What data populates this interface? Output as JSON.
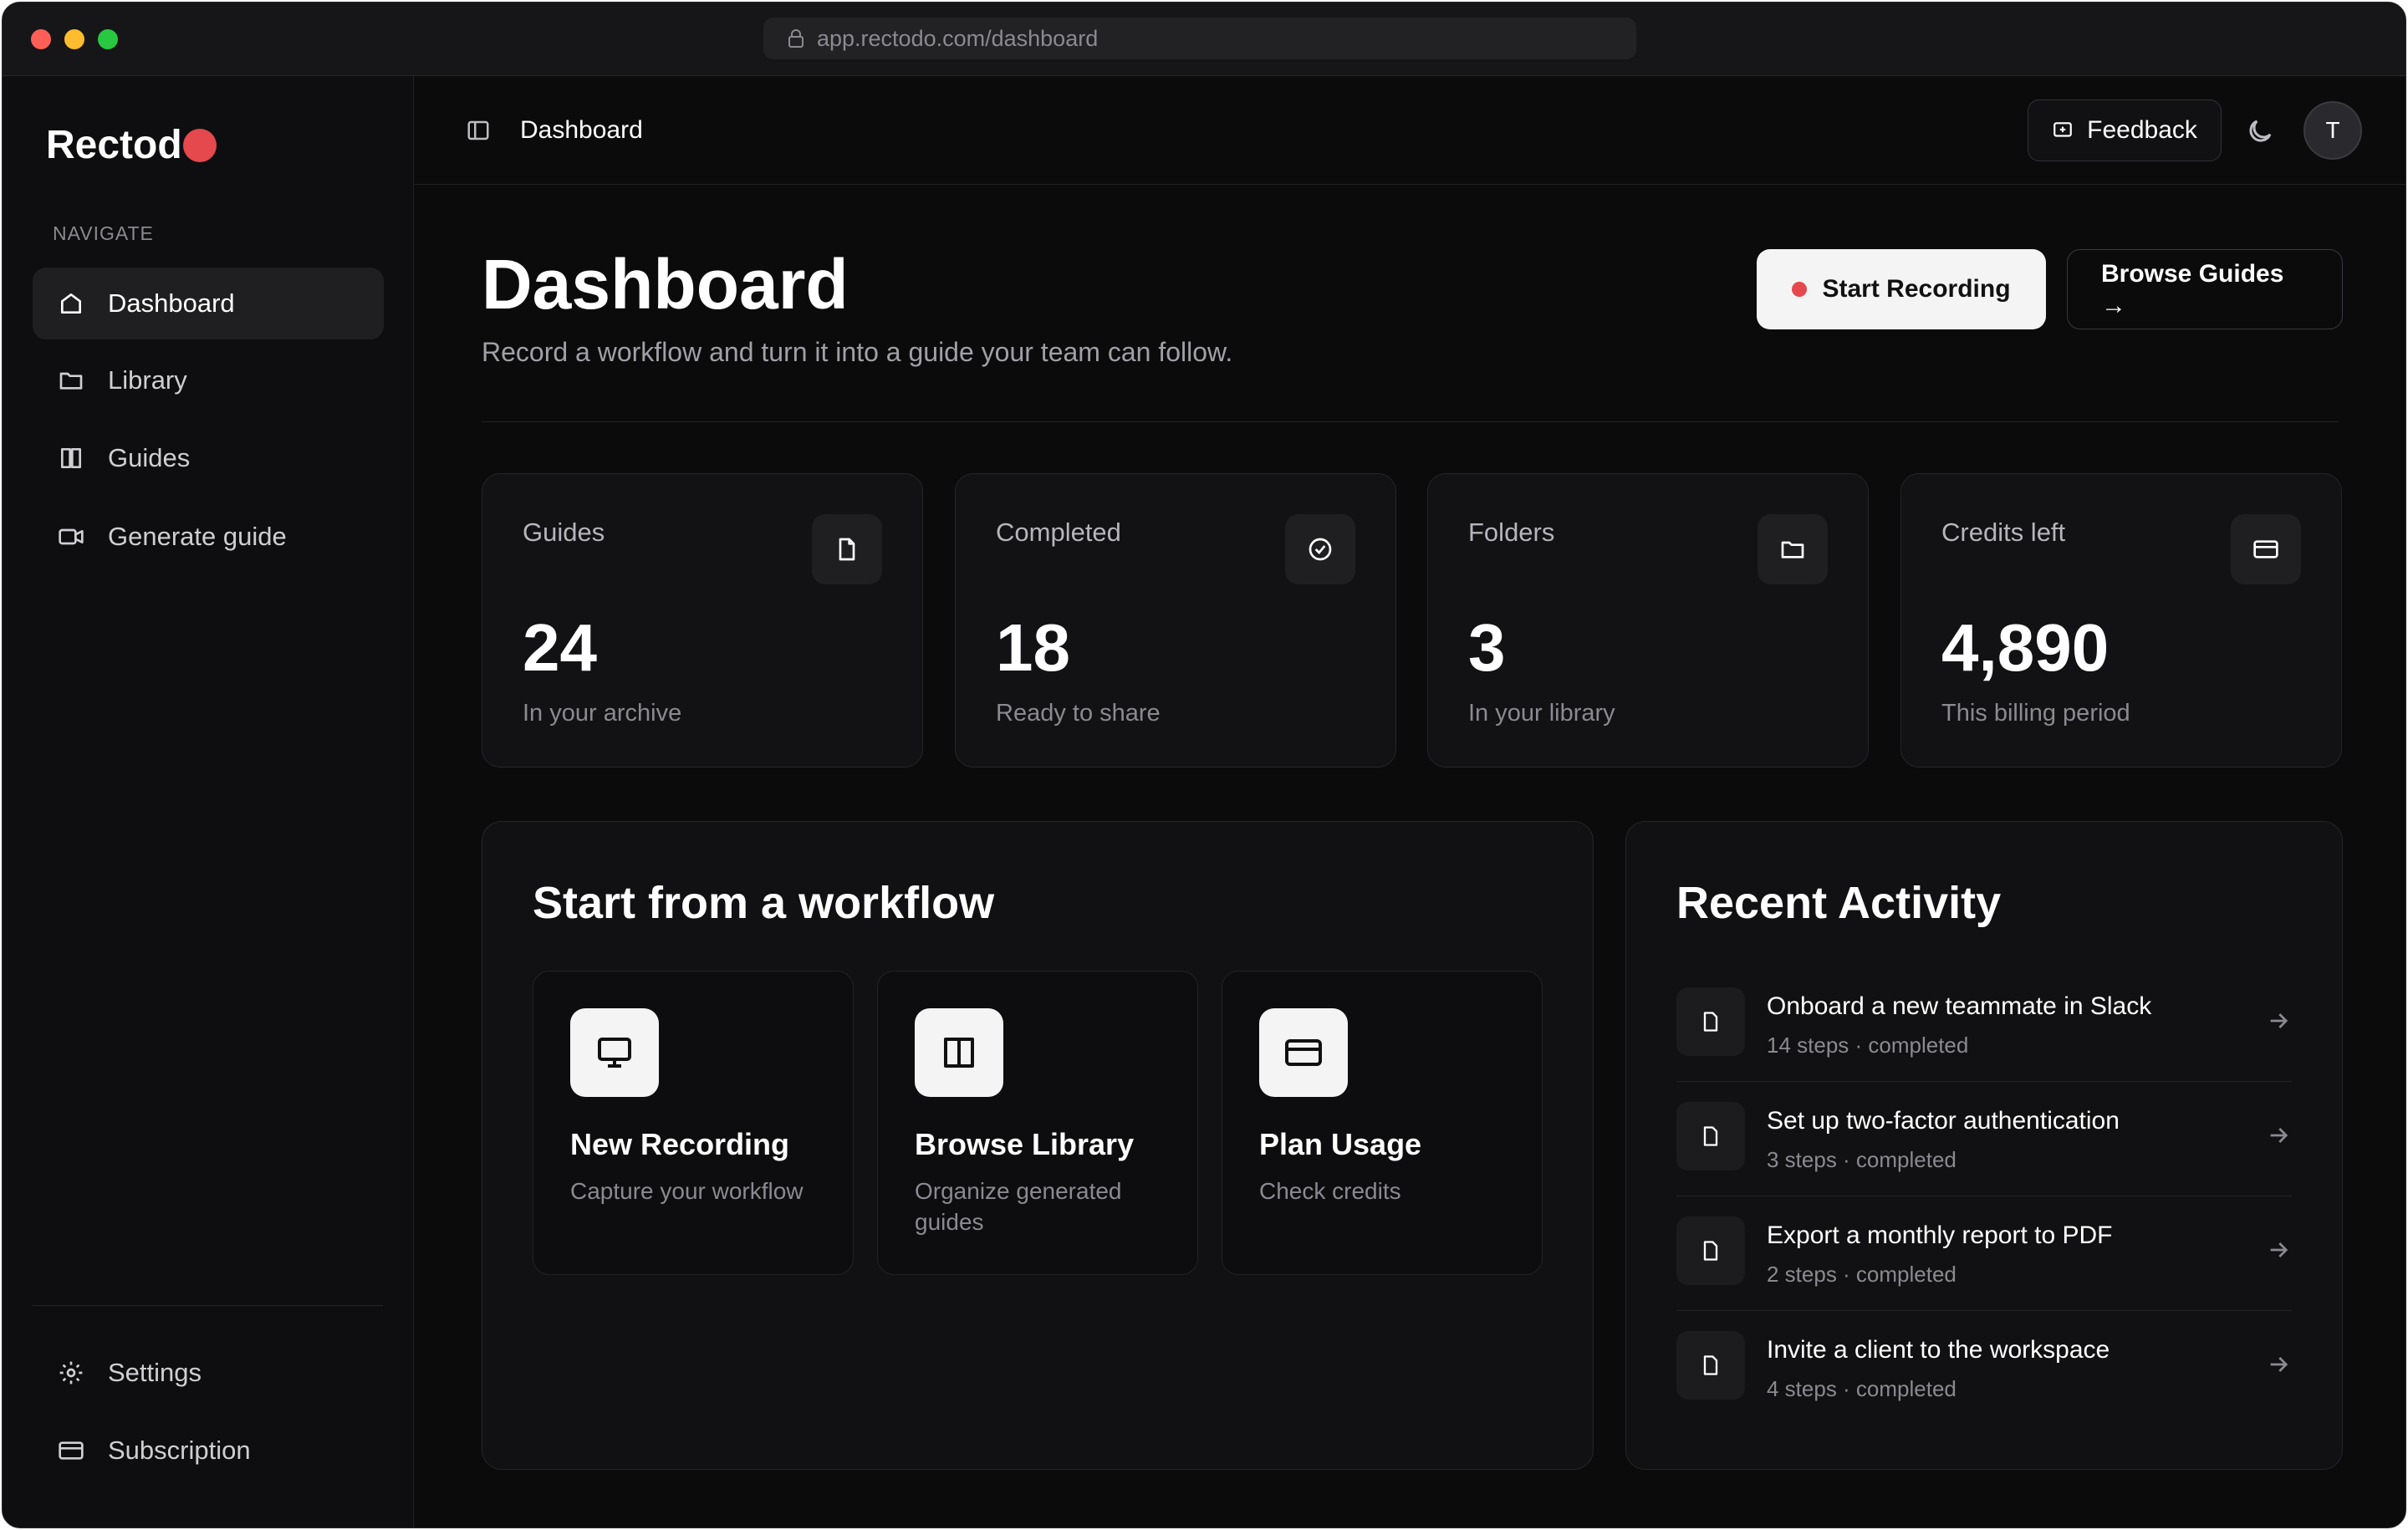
{
  "browser": {
    "url": "app.rectodo.com/dashboard"
  },
  "sidebar": {
    "logo": "Rectod",
    "nav_label": "NAVIGATE",
    "items": [
      {
        "label": "Dashboard",
        "icon": "home-icon",
        "active": true
      },
      {
        "label": "Library",
        "icon": "folder-icon"
      },
      {
        "label": "Guides",
        "icon": "book-icon"
      },
      {
        "label": "Generate guide",
        "icon": "video-icon"
      }
    ],
    "bottom_items": [
      {
        "label": "Settings",
        "icon": "gear-icon"
      },
      {
        "label": "Subscription",
        "icon": "card-icon"
      }
    ]
  },
  "header": {
    "title": "Dashboard",
    "feedback_label": "Feedback",
    "avatar_initial": "T"
  },
  "page": {
    "title": "Dashboard",
    "subtitle": "Record a workflow and turn it into a guide your team can follow.",
    "start_recording_label": "Start Recording",
    "browse_guides_label": "Browse Guides",
    "browse_guides_arrow": "→"
  },
  "stats": [
    {
      "label": "Guides",
      "value": "24",
      "note": "In your archive",
      "icon": "file-icon"
    },
    {
      "label": "Completed",
      "value": "18",
      "note": "Ready to share",
      "icon": "check-circle-icon"
    },
    {
      "label": "Folders",
      "value": "3",
      "note": "In your library",
      "icon": "folder-icon"
    },
    {
      "label": "Credits left",
      "value": "4,890",
      "note": "This billing period",
      "icon": "card-icon"
    }
  ],
  "workflow": {
    "title": "Start from a workflow",
    "cards": [
      {
        "title": "New Recording",
        "desc": "Capture your workflow",
        "icon": "monitor-icon"
      },
      {
        "title": "Browse Library",
        "desc": "Organize generated guides",
        "icon": "book-icon"
      },
      {
        "title": "Plan Usage",
        "desc": "Check credits",
        "icon": "card-icon"
      }
    ]
  },
  "activity": {
    "title": "Recent Activity",
    "items": [
      {
        "title": "Onboard a new teammate in Slack",
        "meta": "14 steps · completed"
      },
      {
        "title": "Set up two-factor authentication",
        "meta": "3 steps · completed"
      },
      {
        "title": "Export a monthly report to PDF",
        "meta": "2 steps · completed"
      },
      {
        "title": "Invite a client to the workspace",
        "meta": "4 steps · completed"
      }
    ]
  },
  "colors": {
    "accent_red": "#e5484d",
    "background": "#0b0b0c",
    "card": "#121214"
  }
}
